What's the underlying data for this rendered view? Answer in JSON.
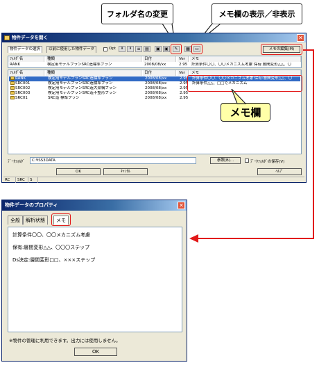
{
  "callouts": {
    "rename": "フォルダ名の変更",
    "memo_toggle": "メモ欄の表示／非表示",
    "memo_field": "メモ欄"
  },
  "main_window": {
    "title": "物件データを開く",
    "tabs": [
      "物件データの選択",
      "以前に使用した物件データ"
    ],
    "option_label": "Opt",
    "memo_edit_button": "メモの編集(M)",
    "filter": {
      "folder_label": "ﾌｫﾙﾀﾞ名",
      "name_label": "種類",
      "date_label": "日付",
      "ver_label": "Ver",
      "memo_label": "メモ",
      "folder_value": "RANK",
      "name_value": "検定用モデルプランSRC造標準プラン",
      "date_value": "2008/08/xx",
      "ver_value": "2.95",
      "memo_value": "計算条件〇〇、〇〇メカニズム考慮 保有:層間変形△△、〇"
    },
    "columns": [
      "ﾌｫﾙﾀﾞ名",
      "種類",
      "日付",
      "Ver",
      "メモ"
    ],
    "rows": [
      {
        "folder": "RANK",
        "name": "検定用モデルプランSRC造標準プラン",
        "date": "2008/08/xx",
        "ver": "2.95",
        "memo": "計算条件〇〇、〇〇メカニズム考慮 保有:層間変形△△、〇"
      },
      {
        "folder": "SRC001",
        "name": "検定用モデルプランSRC造標準プラン",
        "date": "2008/08/xx",
        "ver": "2.95",
        "memo": "計算条件△△、□□でメカニズム"
      },
      {
        "folder": "SRC002",
        "name": "検定用モデルプランSRC造大梁構プラン",
        "date": "2008/08/xx",
        "ver": "2.95",
        "memo": ""
      },
      {
        "folder": "SRC003",
        "name": "検定用モデルプランSRC造不整形プラン",
        "date": "2008/08/xx",
        "ver": "2.95",
        "memo": ""
      },
      {
        "folder": "SRC01",
        "name": "SRC造 標準プラン",
        "date": "2008/08/xx",
        "ver": "2.95",
        "memo": ""
      }
    ],
    "data_folder_label": "ﾃﾞｰﾀﾌｫﾙﾀﾞ",
    "data_folder_value": "C:¥SS3DATA",
    "browse_button": "参照(B)...",
    "save_folder_label": "ﾃﾞｰﾀﾌｫﾙﾀﾞの保存(V)",
    "ok_button": "OK",
    "cancel_button": "ｷｬﾝｾﾙ",
    "help_button": "ﾍﾙﾌﾟ",
    "status": [
      "RC",
      "SRC",
      "S"
    ]
  },
  "props_window": {
    "title": "物件データのプロパティ",
    "tabs": [
      "全般",
      "解析状態",
      "メモ"
    ],
    "memo_lines": [
      "計算条件〇〇、〇〇メカニズム考慮",
      "保有:層間変形△△、〇〇〇ステップ",
      "Ds決定:層間変形□□、×××ステップ"
    ],
    "note": "※物件の管理に利用できます。出力には使用しません。",
    "ok_button": "OK"
  },
  "colors": {
    "highlight_red": "#e21818",
    "selection_blue": "#316ac5",
    "memo_callout_bg": "#ffffa8",
    "titlebar_dark": "#0a246a"
  }
}
